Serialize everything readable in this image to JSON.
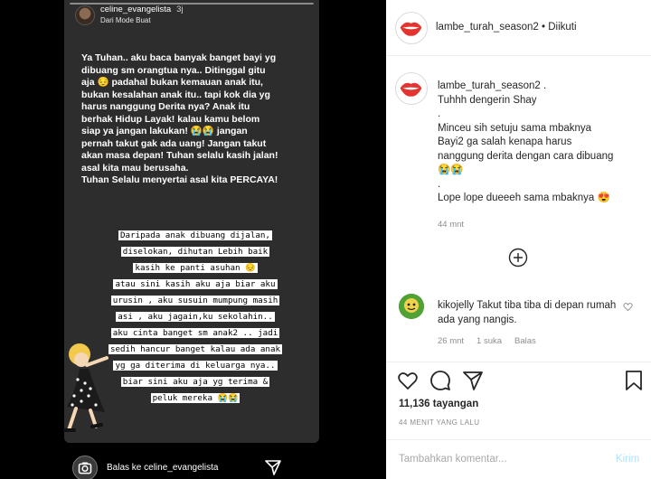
{
  "story": {
    "username": "celine_evangelista",
    "time": "3j",
    "subtitle": "Dari Mode Buat",
    "bold_lines": [
      "Ya Tuhan.. aku baca banyak banget bayi yg",
      "dibuang sm orangtua nya.. Ditinggal gitu",
      "aja 😔 padahal bukan kemauan anak itu,",
      "bukan kesalahan anak itu.. tapi kok dia yg",
      "harus nanggung Derita nya? Anak itu",
      "berhak Hidup Layak! kalau kamu belom",
      "siap ya jangan lakukan! 😭😭 jangan",
      "pernah takut gak ada uang! Jangan takut",
      "akan masa depan! Tuhan selalu kasih jalan!",
      "asal kita mau berusaha.",
      "Tuhan Selalu menyertai asal kita PERCAYA!"
    ],
    "mono_lines": [
      "Daripada anak dibuang dijalan,",
      "diselokan, dihutan Lebih baik",
      "kasih ke panti asuhan 😔",
      "atau sini kasih aku aja biar aku",
      "urusin , aku susuin mumpung masih",
      "asi , aku jagain,ku sekolahin..",
      "aku cinta banget sm anak2 .. jadi",
      "sedih hancur banget kalau ada anak",
      "yg ga diterima di keluarga nya..",
      "biar sini aku aja yg terima &",
      "peluk mereka 😭😭"
    ],
    "reply_placeholder": "Balas ke celine_evangelista"
  },
  "header": {
    "username": "lambe_turah_season2",
    "follow_status": " • Diikuti"
  },
  "caption": {
    "username": "lambe_turah_season2",
    "suffix": " .",
    "lines": [
      "Tuhhh dengerin Shay",
      ".",
      "Minceu sih setuju sama mbaknya",
      "Bayi2 ga salah kenapa harus",
      "nanggung derita dengan cara dibuang",
      "😭😭",
      ".",
      "Lope lope dueeeh sama mbaknya 😍"
    ],
    "time": "44 mnt"
  },
  "comment": {
    "username": "kikojelly",
    "text": " Takut tiba tiba di depan rumah ada yang nangis.",
    "time": "26 mnt",
    "likes": "1 suka",
    "reply": "Balas"
  },
  "stats": {
    "views": "11,136 tayangan",
    "ago": "44 MENIT YANG LALU"
  },
  "comment_box": {
    "placeholder": "Tambahkan komentar...",
    "post": "Kirim"
  },
  "colors": {
    "brand_red": "#e3342f",
    "link_blue": "#b2dffc",
    "story_bg": "#2d2d2d"
  }
}
